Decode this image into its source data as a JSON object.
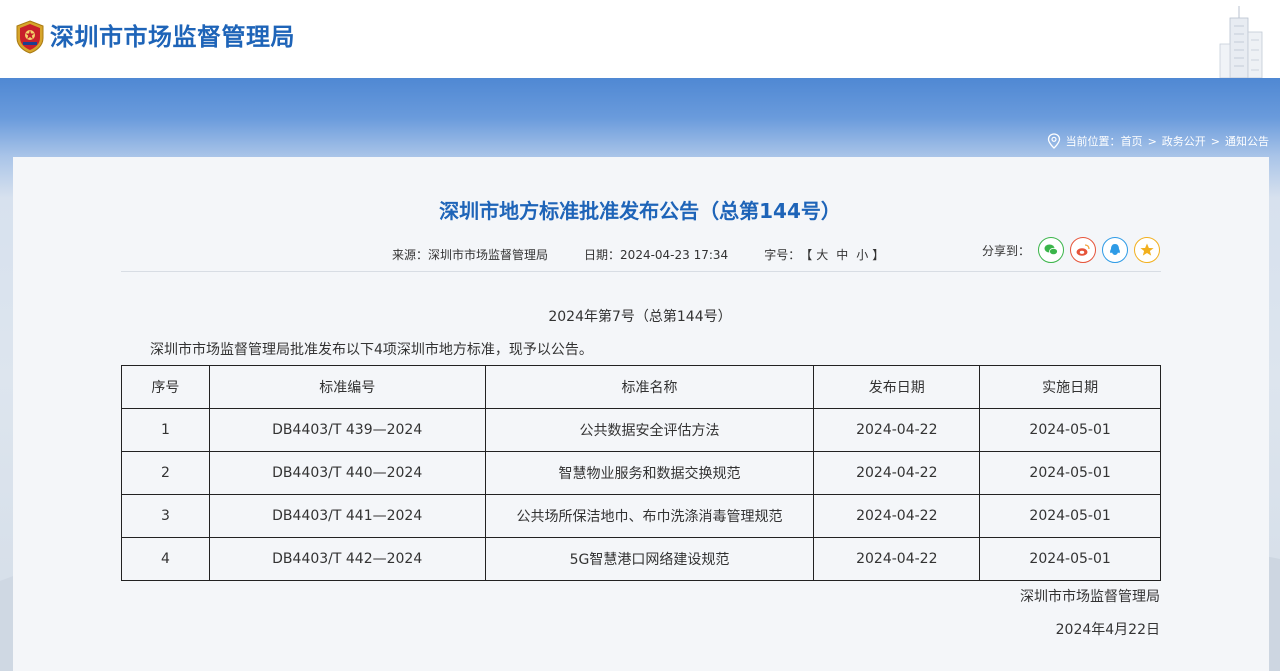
{
  "site": {
    "title": "深圳市市场监督管理局"
  },
  "breadcrumb": {
    "prefix": "当前位置：",
    "items": [
      "首页",
      "政务公开",
      "通知公告"
    ],
    "separator": ">"
  },
  "article": {
    "title": "深圳市地方标准批准发布公告（总第144号）",
    "source_label": "来源：",
    "source_value": "深圳市市场监督管理局",
    "date_label": "日期：",
    "date_value": "2024-04-23 17:34",
    "fontsize_label": "字号：",
    "fontsize_open": "【",
    "fontsize_large": "大",
    "fontsize_medium": "中",
    "fontsize_small": "小",
    "fontsize_close": "】",
    "share_label": "分享到：",
    "share_icons": [
      "wechat-icon",
      "weibo-icon",
      "qq-icon",
      "qzone-icon"
    ],
    "issue_number": "2024年第7号（总第144号）",
    "intro": "深圳市市场监督管理局批准发布以下4项深圳市地方标准，现予以公告。",
    "signature_org": "深圳市市场监督管理局",
    "signature_date": "2024年4月22日"
  },
  "table": {
    "headers": [
      "序号",
      "标准编号",
      "标准名称",
      "发布日期",
      "实施日期"
    ],
    "rows": [
      [
        "1",
        "DB4403/T 439—2024",
        "公共数据安全评估方法",
        "2024-04-22",
        "2024-05-01"
      ],
      [
        "2",
        "DB4403/T 440—2024",
        "智慧物业服务和数据交换规范",
        "2024-04-22",
        "2024-05-01"
      ],
      [
        "3",
        "DB4403/T 441—2024",
        "公共场所保洁地巾、布巾洗涤消毒管理规范",
        "2024-04-22",
        "2024-05-01"
      ],
      [
        "4",
        "DB4403/T 442—2024",
        "5G智慧港口网络建设规范",
        "2024-04-22",
        "2024-05-01"
      ]
    ]
  },
  "colors": {
    "brand_blue": "#1e64b8",
    "wechat": "#3bb54a",
    "weibo": "#e6543a",
    "qq": "#2e9be6",
    "qzone": "#f2b01e"
  }
}
